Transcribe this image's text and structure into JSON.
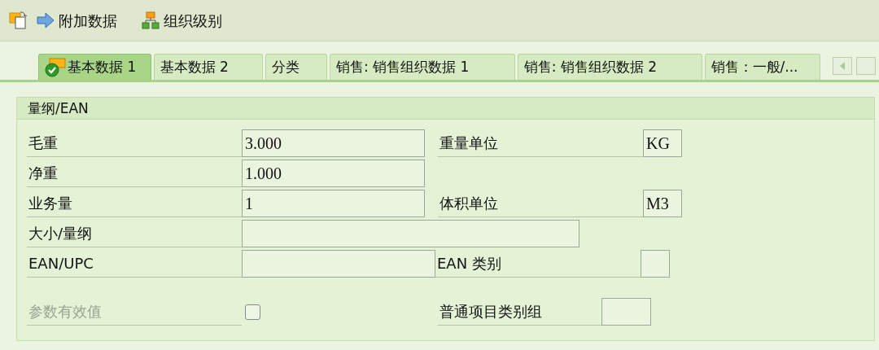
{
  "toolbar": {
    "buttons": [
      {
        "label": "附加数据"
      },
      {
        "label": "组织级别"
      }
    ]
  },
  "tabs": [
    {
      "label": "基本数据 1",
      "selected": true
    },
    {
      "label": "基本数据 2",
      "selected": false
    },
    {
      "label": "分类",
      "selected": false
    },
    {
      "label": "销售: 销售组织数据 1",
      "selected": false
    },
    {
      "label": "销售: 销售组织数据 2",
      "selected": false
    },
    {
      "label": "销售：一般/...",
      "selected": false
    }
  ],
  "group": {
    "title": "量纲/EAN",
    "rows": [
      {
        "cells": [
          {
            "kind": "label",
            "text": "毛重",
            "disabled": false
          },
          {
            "kind": "field",
            "value": "3.000"
          },
          {
            "kind": "label",
            "text": "重量单位",
            "disabled": false
          },
          {
            "kind": "field",
            "value": "KG"
          }
        ]
      },
      {
        "cells": [
          {
            "kind": "label",
            "text": "净重",
            "disabled": false
          },
          {
            "kind": "field",
            "value": "1.000"
          }
        ]
      },
      {
        "cells": [
          {
            "kind": "label",
            "text": "业务量",
            "disabled": false
          },
          {
            "kind": "field",
            "value": "1"
          },
          {
            "kind": "label",
            "text": "体积单位",
            "disabled": false
          },
          {
            "kind": "field",
            "value": "M3"
          }
        ]
      },
      {
        "cells": [
          {
            "kind": "label",
            "text": "大小/量纲",
            "disabled": false
          },
          {
            "kind": "field"
          }
        ]
      },
      {
        "cells": [
          {
            "kind": "label",
            "text": "EAN/UPC",
            "disabled": false
          },
          {
            "kind": "field"
          },
          {
            "kind": "label",
            "text": "EAN 类别",
            "disabled": false
          },
          {
            "kind": "field"
          }
        ]
      },
      {
        "cells": [
          {
            "kind": "label",
            "text": "参数有效值",
            "disabled": true
          },
          {
            "kind": "checkbox",
            "checked": false
          },
          {
            "kind": "label",
            "text": "普通项目类别组",
            "disabled": false
          },
          {
            "kind": "field"
          }
        ]
      }
    ]
  }
}
